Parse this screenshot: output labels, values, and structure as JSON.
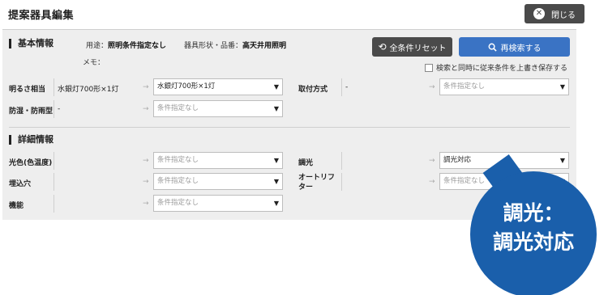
{
  "header": {
    "title": "提案器具編集",
    "close_label": "閉じる",
    "close_icon": "close-icon"
  },
  "basic": {
    "section_title": "基本情報",
    "usage_label": "用途：",
    "usage_value": "照明条件指定なし",
    "shape_label": "器具形状・品番：",
    "shape_value": "高天井用照明",
    "memo_label": "メモ："
  },
  "actions": {
    "reset_label": "全条件リセット",
    "search_label": "再検索する",
    "save_checkbox_label": "検索と同時に従来条件を上書き保存する"
  },
  "basic_rows": [
    {
      "label": "明るさ相当",
      "value": "水銀灯700形×1灯",
      "select": "水銀灯700形×1灯",
      "placeholder": false
    },
    {
      "label": "取付方式",
      "value": "-",
      "select": "条件指定なし",
      "placeholder": true
    },
    {
      "label": "防湿・防雨型",
      "value": "-",
      "select": "条件指定なし",
      "placeholder": true
    }
  ],
  "detail": {
    "section_title": "詳細情報",
    "rows": [
      {
        "label": "光色(色温度)",
        "value": "",
        "select": "条件指定なし",
        "placeholder": true
      },
      {
        "label": "調光",
        "value": "",
        "select": "調光対応",
        "placeholder": false
      },
      {
        "label": "埋込穴",
        "value": "",
        "select": "条件指定なし",
        "placeholder": true
      },
      {
        "label": "オートリフター",
        "value": "",
        "select": "条件指定なし",
        "placeholder": true
      },
      {
        "label": "機能",
        "value": "",
        "select": "条件指定なし",
        "placeholder": true
      }
    ]
  },
  "callout": {
    "line1": "調光：",
    "line2": "調光対応"
  },
  "colors": {
    "accent": "#3a73c4",
    "callout": "#1a5fab",
    "dark_button": "#4a4a4a",
    "panel_bg": "#eeeeee"
  }
}
